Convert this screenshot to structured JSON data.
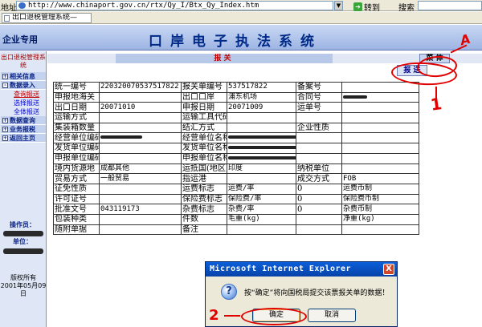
{
  "browser": {
    "address_label": "地址",
    "url": "http://www.chinaport.gov.cn/rtx/Qy_I/Btx_Qy_Index.htm",
    "go_label": "转到",
    "search_label": "搜索",
    "tab_title": "出口退税管理系统—"
  },
  "app": {
    "brand": "企业专用",
    "title": "口岸电子执法系统"
  },
  "sidebar": {
    "title": "出口退税管理系统",
    "items": [
      {
        "label": "相关信息",
        "type": "head",
        "toggle": "+"
      },
      {
        "label": "数据录入",
        "type": "head",
        "toggle": "-"
      },
      {
        "label": "查询报送",
        "type": "sub",
        "active": true
      },
      {
        "label": "选择报送",
        "type": "sub",
        "active": false
      },
      {
        "label": "全体报送",
        "type": "sub",
        "active": false
      },
      {
        "label": "数据查询",
        "type": "head",
        "toggle": "+"
      },
      {
        "label": "业务报税",
        "type": "head",
        "toggle": "+"
      },
      {
        "label": "返回主页",
        "type": "head",
        "toggle": "+"
      }
    ],
    "operator_label": "操作员：",
    "unit_label": "单位：",
    "copyright_line1": "版权所有",
    "copyright_line2": "2001年05月09日"
  },
  "main": {
    "subhead_label": "报 关",
    "menu_button": "菜 体",
    "send_button": "报 送"
  },
  "form": {
    "rows": [
      [
        "统一编号",
        "220320070537517822",
        "报关单编号",
        "537517822",
        "备案号",
        ""
      ],
      [
        "申报地海关",
        "",
        "出口口岸",
        "浦东机场",
        "合同号",
        "REDACT"
      ],
      [
        "出口日期",
        "20071010",
        "申报日期",
        "20071009",
        "运单号",
        ""
      ],
      [
        "运输方式",
        "",
        "运输工具代码及名称",
        "",
        "",
        ""
      ],
      [
        "集装箱数量",
        "",
        "结汇方式",
        "",
        "企业性质",
        ""
      ],
      [
        "经营单位编码",
        "REDACT",
        "经营单位名称",
        "REDACT",
        "",
        ""
      ],
      [
        "发货单位编码",
        "",
        "发货单位名称",
        "REDACT",
        "",
        ""
      ],
      [
        "申报单位编码",
        "",
        "申报单位名称",
        "REDACT",
        "",
        ""
      ],
      [
        "境内货源地",
        "成都其他",
        "运抵国(地区)",
        "印度",
        "纳税单位",
        ""
      ],
      [
        "贸易方式",
        "一般贸易",
        "指运港",
        "",
        "成交方式",
        "FOB"
      ],
      [
        "征免性质",
        "",
        "运费标志",
        "运费/率",
        "0",
        "运费币制"
      ],
      [
        "许可证号",
        "",
        "保险费标志",
        "保险费/率",
        "0",
        "保险费币制"
      ],
      [
        "批准文号",
        "043119173",
        "杂费标志",
        "杂费/率",
        "0",
        "杂费币制"
      ],
      [
        "包装种类",
        "",
        "件数",
        "毛重(kg)",
        "",
        "净重(kg)"
      ],
      [
        "随附单据",
        "",
        "备注",
        "",
        "",
        ""
      ]
    ]
  },
  "dialog": {
    "title": "Microsoft Internet Explorer",
    "close_symbol": "X",
    "icon_glyph": "?",
    "message": "按“确定”将向国税局提交该票报关单的数据！",
    "ok_label": "确定",
    "cancel_label": "取消"
  },
  "annotations": {
    "a_label": "A",
    "one_label": "1",
    "two_label": "2"
  },
  "colors": {
    "annotation": "#e00000",
    "dialog_title_bar": "#0a5fd8",
    "header_text": "#002a88"
  }
}
